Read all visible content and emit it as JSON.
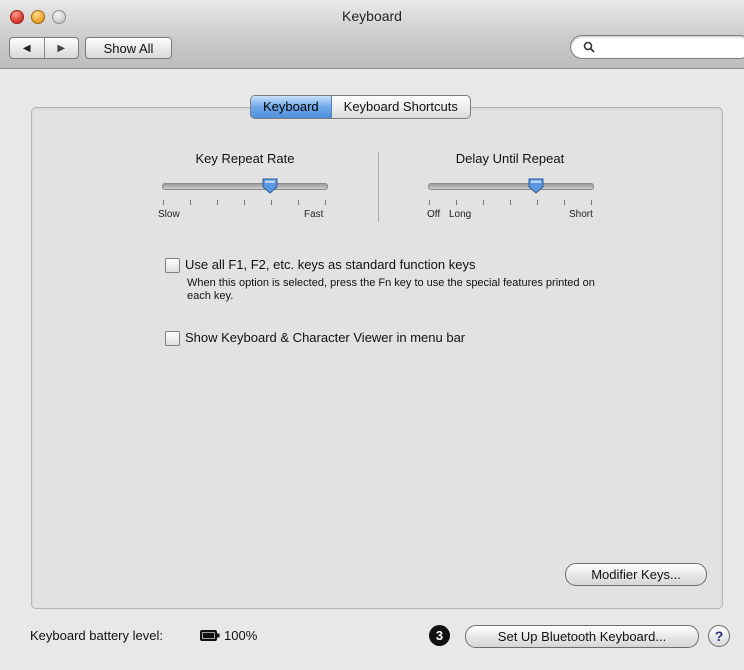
{
  "window": {
    "title": "Keyboard"
  },
  "toolbar": {
    "back_icon": "triangle-left",
    "forward_icon": "triangle-right",
    "show_all_label": "Show All",
    "search_placeholder": ""
  },
  "tabs": [
    {
      "label": "Keyboard",
      "selected": true
    },
    {
      "label": "Keyboard Shortcuts",
      "selected": false
    }
  ],
  "key_repeat": {
    "title": "Key Repeat Rate",
    "min_label": "Slow",
    "max_label": "Fast",
    "value_fraction": 0.66
  },
  "delay_repeat": {
    "title": "Delay Until Repeat",
    "min_label": "Off",
    "second_label": "Long",
    "max_label": "Short",
    "value_fraction": 0.66
  },
  "options": {
    "function_keys_label": "Use all F1, F2, etc. keys as standard function keys",
    "function_keys_note": "When this option is selected, press the Fn key to use the special features printed on each key.",
    "function_keys_checked": false,
    "viewer_label": "Show Keyboard & Character Viewer in menu bar",
    "viewer_checked": false
  },
  "buttons": {
    "modifier_keys": "Modifier Keys...",
    "setup_bluetooth": "Set Up Bluetooth Keyboard...",
    "help": "?"
  },
  "footer": {
    "battery_label": "Keyboard battery level:",
    "battery_value": "100%",
    "callout_number": "3"
  },
  "colors": {
    "accent": "#4f8fde",
    "thumb": "#5b97e0"
  }
}
